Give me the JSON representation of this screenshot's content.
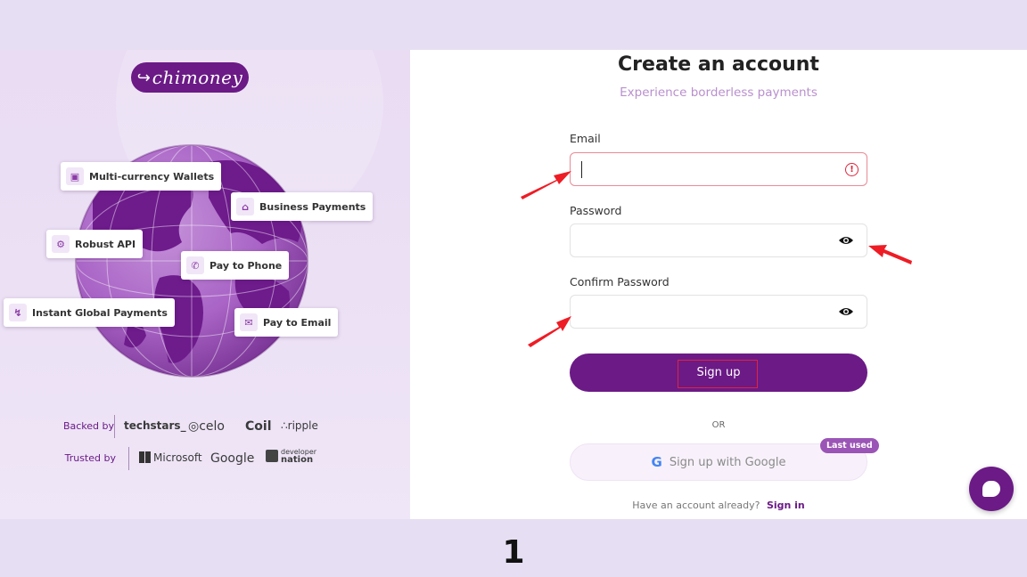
{
  "brand": {
    "logo_text": "chimoney"
  },
  "features": [
    {
      "label": "Multi-currency Wallets",
      "icon": "wallet-icon"
    },
    {
      "label": "Business Payments",
      "icon": "bank-icon"
    },
    {
      "label": "Robust API",
      "icon": "gear-icon"
    },
    {
      "label": "Pay to Phone",
      "icon": "phone-icon"
    },
    {
      "label": "Instant Global Payments",
      "icon": "lightning-icon"
    },
    {
      "label": "Pay to Email",
      "icon": "mail-icon"
    }
  ],
  "backed": {
    "label": "Backed by",
    "brands": [
      "techstars_",
      "celo",
      "Coil",
      "ripple"
    ]
  },
  "trusted": {
    "label": "Trusted by",
    "brands": [
      "Microsoft",
      "Google",
      "developer",
      "nation"
    ]
  },
  "form": {
    "title": "Create an account",
    "subtitle": "Experience borderless payments",
    "email_label": "Email",
    "email_value": "",
    "password_label": "Password",
    "password_value": "",
    "confirm_label": "Confirm Password",
    "confirm_value": "",
    "signup_label": "Sign up",
    "or_text": "OR",
    "google_label": "Sign up with Google",
    "last_used_badge": "Last used",
    "have_account_text": "Have an account already?",
    "signin_link": "Sign in"
  },
  "step_number": "1",
  "colors": {
    "brand": "#6b1a86",
    "accent": "#b98fce",
    "error": "#e0243c",
    "annotation": "#e0243c"
  }
}
